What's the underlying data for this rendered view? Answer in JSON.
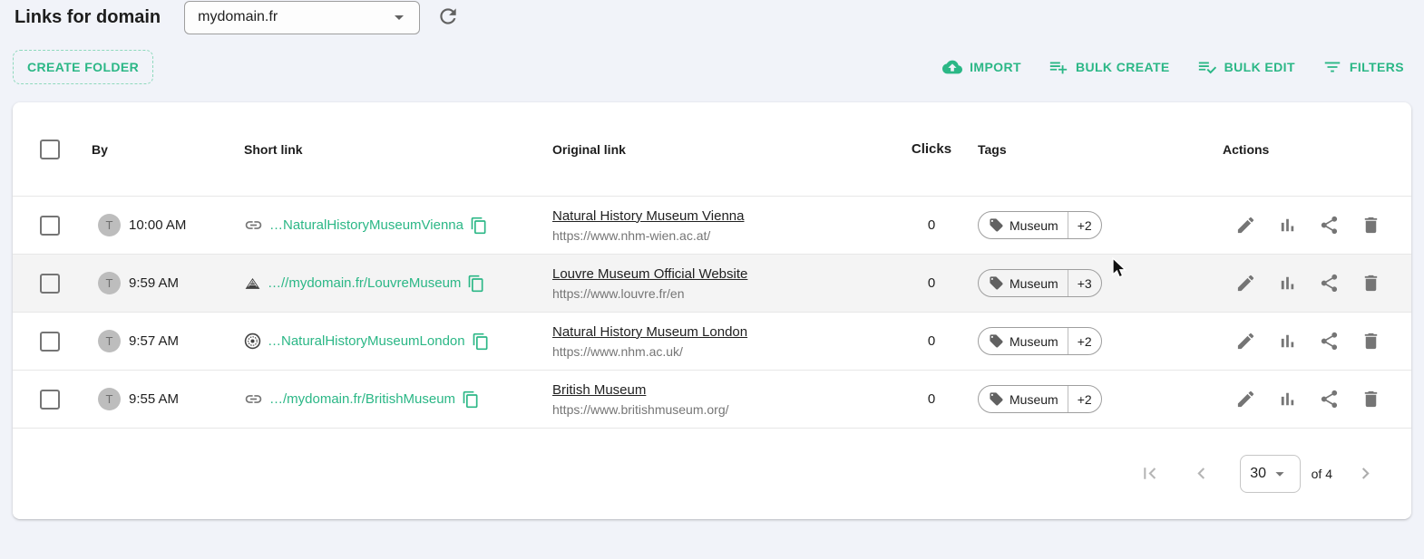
{
  "header": {
    "title": "Links for domain",
    "domain_select": {
      "value": "mydomain.fr"
    }
  },
  "toolbar": {
    "create_folder": "CREATE FOLDER",
    "import": "IMPORT",
    "bulk_create": "BULK CREATE",
    "bulk_edit": "BULK EDIT",
    "filters": "FILTERS"
  },
  "table": {
    "headers": {
      "by": "By",
      "short_link": "Short link",
      "original_link": "Original link",
      "clicks": "Clicks",
      "tags": "Tags",
      "actions": "Actions"
    },
    "rows": [
      {
        "avatar_initial": "T",
        "created_time": "10:00 AM",
        "favicon": "link-icon",
        "short_link": "…NaturalHistoryMuseumVienna",
        "original_title": "Natural History Museum Vienna",
        "original_url": "https://www.nhm-wien.ac.at/",
        "clicks": "0",
        "tags": {
          "primary": "Museum",
          "overflow": "+2"
        }
      },
      {
        "avatar_initial": "T",
        "created_time": "9:59 AM",
        "favicon": "louvre-pyramid-favicon",
        "short_link": "…//mydomain.fr/LouvreMuseum",
        "original_title": "Louvre Museum Official Website",
        "original_url": "https://www.louvre.fr/en",
        "clicks": "0",
        "tags": {
          "primary": "Museum",
          "overflow": "+3"
        }
      },
      {
        "avatar_initial": "T",
        "created_time": "9:57 AM",
        "favicon": "nhm-london-rosette-favicon",
        "short_link": "…NaturalHistoryMuseumLondon",
        "original_title": "Natural History Museum London",
        "original_url": "https://www.nhm.ac.uk/",
        "clicks": "0",
        "tags": {
          "primary": "Museum",
          "overflow": "+2"
        }
      },
      {
        "avatar_initial": "T",
        "created_time": "9:55 AM",
        "favicon": "link-icon",
        "short_link": "…/mydomain.fr/BritishMuseum",
        "original_title": "British Museum",
        "original_url": "https://www.britishmuseum.org/",
        "clicks": "0",
        "tags": {
          "primary": "Museum",
          "overflow": "+2"
        }
      }
    ]
  },
  "pagination": {
    "page_size": "30",
    "range_label": "of 4"
  },
  "colors": {
    "accent": "#2bb786",
    "page_background": "#f1f3f9",
    "row_hover": "#f4f4f4",
    "icon_gray": "#757575",
    "text_primary": "#212121",
    "text_secondary": "#757575"
  }
}
